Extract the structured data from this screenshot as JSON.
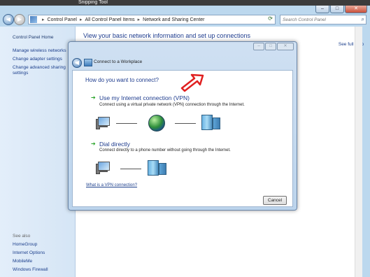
{
  "snipping_tool": {
    "title": "Snipping Tool"
  },
  "explorer": {
    "breadcrumbs": [
      "Control Panel",
      "All Control Panel Items",
      "Network and Sharing Center"
    ],
    "search_placeholder": "Search Control Panel",
    "left_nav": {
      "home": "Control Panel Home",
      "links": [
        "Manage wireless networks",
        "Change adapter settings",
        "Change advanced sharing settings"
      ],
      "see_also_label": "See also",
      "see_also_links": [
        "HomeGroup",
        "Internet Options",
        "MobileMe",
        "Windows Firewall"
      ]
    },
    "main_title": "View your basic network information and set up connections",
    "see_full_map": "See full map"
  },
  "dialog": {
    "title": "Connect to a Workplace",
    "heading": "How do you want to connect?",
    "options": [
      {
        "title": "Use my Internet connection (VPN)",
        "description": "Connect using a virtual private network (VPN) connection through the Internet."
      },
      {
        "title": "Dial directly",
        "description": "Connect directly to a phone number without going through the Internet."
      }
    ],
    "help_link": "What is a VPN connection?",
    "cancel_label": "Cancel"
  },
  "icons": {
    "back": "back-arrow-icon",
    "computer": "computer-icon",
    "globe": "globe-icon",
    "server": "server-icon",
    "annotation": "red-arrow-annotation"
  },
  "colors": {
    "link": "#1c3f8c",
    "heading": "#1e3c8e",
    "annotation": "#e02020"
  }
}
